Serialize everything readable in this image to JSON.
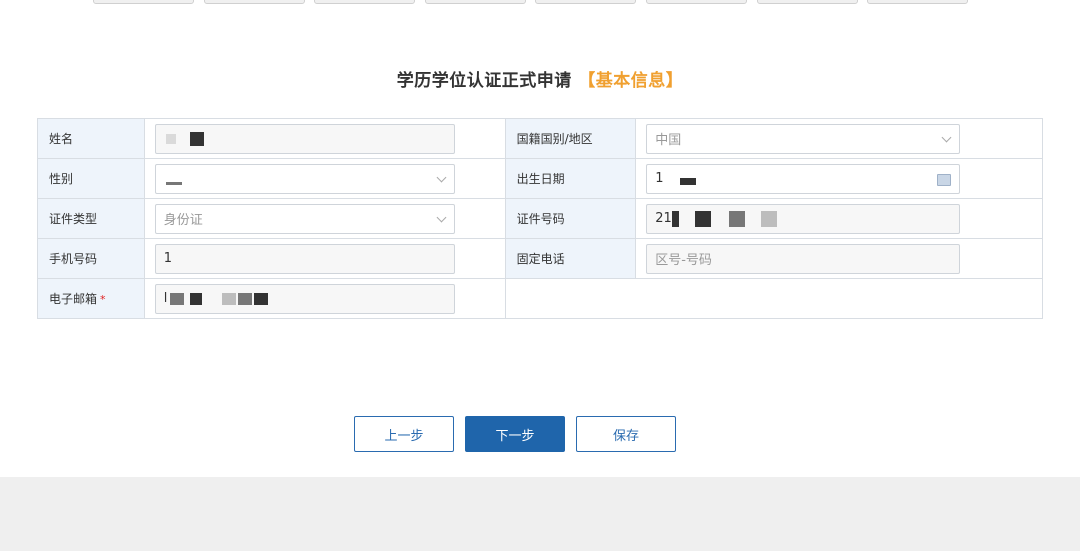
{
  "page": {
    "title_main": "学历学位认证正式申请",
    "title_section": "【基本信息】"
  },
  "form": {
    "name_label": "姓名",
    "name_value": "",
    "nationality_label": "国籍国别/地区",
    "nationality_value": "中国",
    "gender_label": "性别",
    "gender_value": "",
    "birthdate_label": "出生日期",
    "birthdate_value": "1",
    "id_type_label": "证件类型",
    "id_type_value": "身份证",
    "id_number_label": "证件号码",
    "id_number_value": "21",
    "mobile_label": "手机号码",
    "mobile_value": "1",
    "landline_label": "固定电话",
    "landline_placeholder": "区号-号码",
    "email_label": "电子邮箱",
    "email_required_mark": "*",
    "email_value": "l"
  },
  "buttons": {
    "prev_label": "上一步",
    "next_label": "下一步",
    "save_label": "保存"
  },
  "colors": {
    "accent": "#f0a030",
    "primary": "#1f65ab",
    "label_bg": "#eef4fb",
    "required": "#e02020"
  },
  "icons": {
    "dropdown": "chevron-down-icon",
    "date_picker": "calendar-icon"
  }
}
